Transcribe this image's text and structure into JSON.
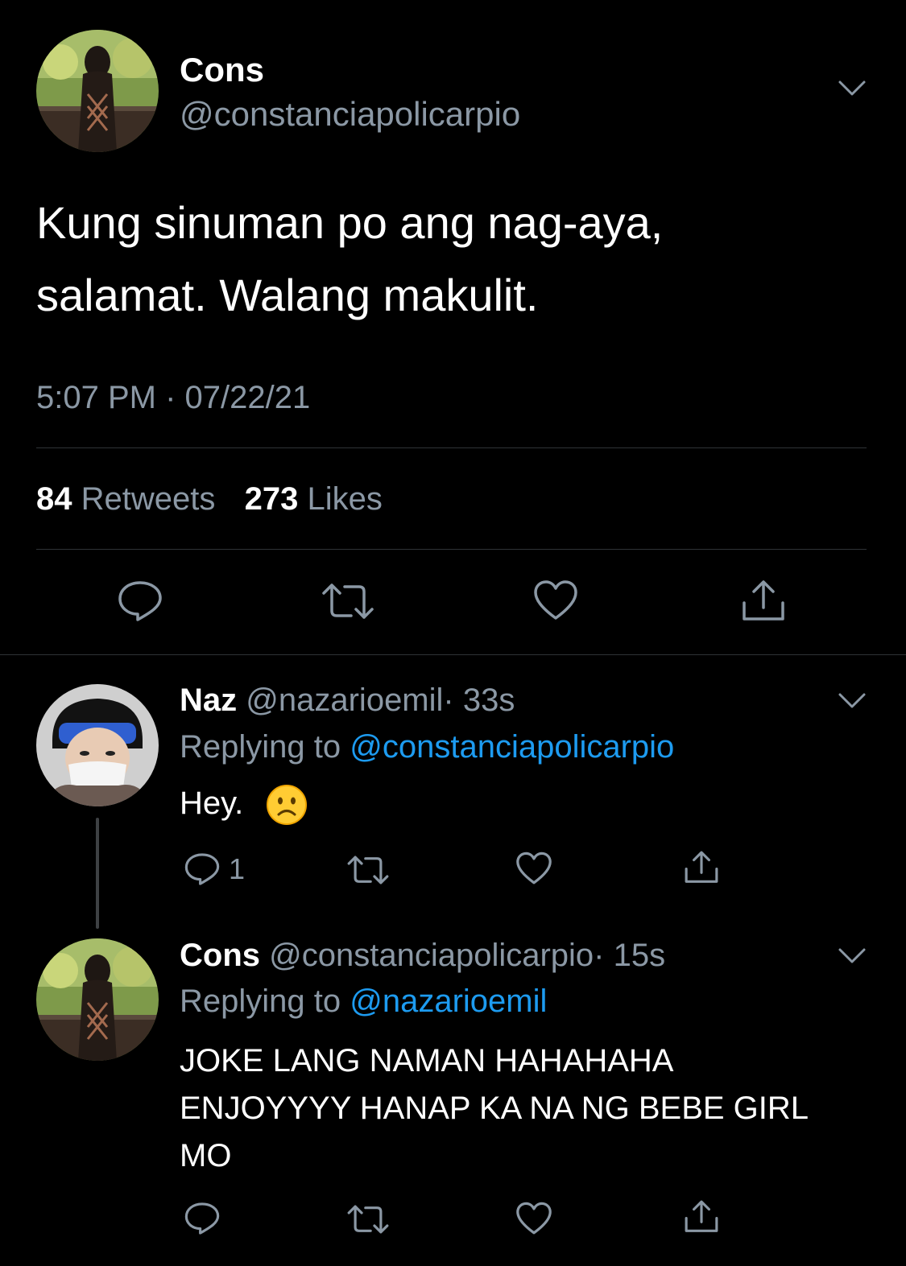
{
  "main_tweet": {
    "display_name": "Cons",
    "handle": "@constanciapolicarpio",
    "text_line1": "Kung sinuman po ang nag-aya,",
    "text_line2": "salamat. Walang makulit.",
    "timestamp": "5:07 PM · 07/22/21",
    "retweets_count": "84",
    "retweets_label": "Retweets",
    "likes_count": "273",
    "likes_label": "Likes"
  },
  "reply1": {
    "display_name": "Naz",
    "handle": "@nazarioemil",
    "time": "· 33s",
    "replying_label": "Replying to",
    "replying_to": "@constanciapolicarpio",
    "text": "Hey.",
    "emoji": "☹️",
    "reply_count": "1"
  },
  "reply2": {
    "display_name": "Cons",
    "handle": "@constanciapolicarpio",
    "time": "· 15s",
    "replying_label": "Replying to",
    "replying_to": "@nazarioemil",
    "text_line1": "JOKE LANG NAMAN HAHAHAHA",
    "text_line2": "ENJOYYYY HANAP KA NA NG BEBE GIRL",
    "text_line3": "MO"
  },
  "icons": {
    "reply": "reply-icon",
    "retweet": "retweet-icon",
    "like": "heart-icon",
    "share": "share-icon",
    "more": "chevron-down-icon"
  },
  "colors": {
    "background": "#000000",
    "secondary_text": "#8b98a5",
    "link": "#1d9bf0",
    "divider": "#2f3336"
  }
}
